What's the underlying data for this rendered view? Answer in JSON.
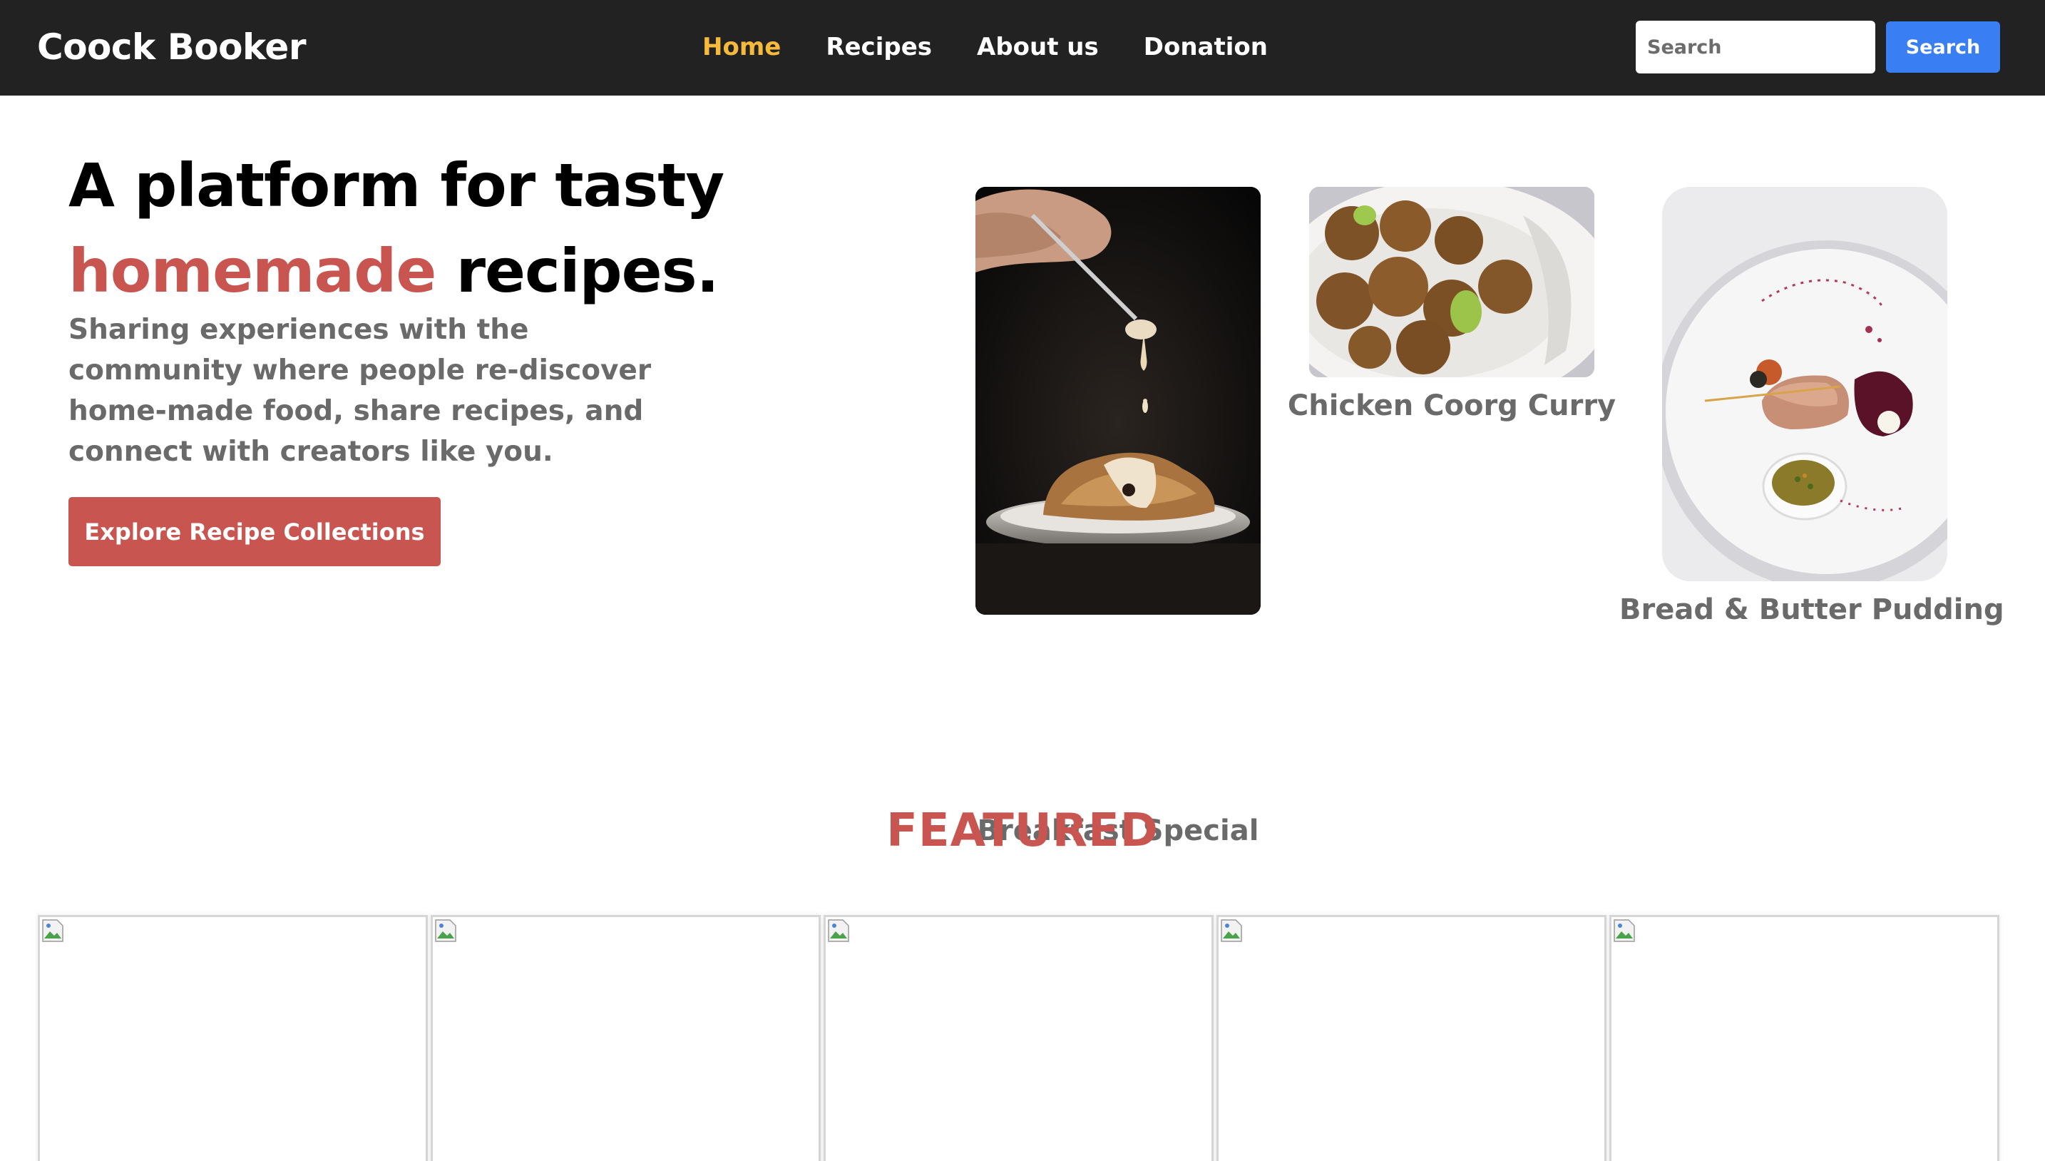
{
  "navbar": {
    "brand": "Coock Booker",
    "links": [
      {
        "label": "Home",
        "active": true
      },
      {
        "label": "Recipes",
        "active": false
      },
      {
        "label": "About us",
        "active": false
      },
      {
        "label": "Donation",
        "active": false
      }
    ],
    "search": {
      "placeholder": "Search",
      "value": "",
      "button_label": "Search"
    }
  },
  "hero": {
    "title_line1": "A platform for tasty",
    "title_accent": "homemade",
    "title_rest": " recipes.",
    "description": "Sharing experiences with the community where people re-discover home-made food, share recipes, and connect with creators like you.",
    "cta_label": "Explore Recipe Collections"
  },
  "hero_cards": [
    {
      "caption": "Breakfast Special",
      "image": "dessert-with-sauce-drip-photo"
    },
    {
      "caption": "Chicken Coorg Curry",
      "image": "falafel-bowl-photo"
    },
    {
      "caption": "Bread & Butter Pudding",
      "image": "plated-fish-dish-photo"
    }
  ],
  "featured": {
    "title": "FEATURED",
    "cards": [
      {
        "image": "broken-image-icon"
      },
      {
        "image": "broken-image-icon"
      },
      {
        "image": "broken-image-icon"
      },
      {
        "image": "broken-image-icon"
      },
      {
        "image": "broken-image-icon"
      }
    ]
  },
  "colors": {
    "navbar_bg": "#222222",
    "active_link": "#f5b93b",
    "accent": "#c95550",
    "search_button": "#3a7ef4",
    "muted_text": "#6a6a6a"
  }
}
